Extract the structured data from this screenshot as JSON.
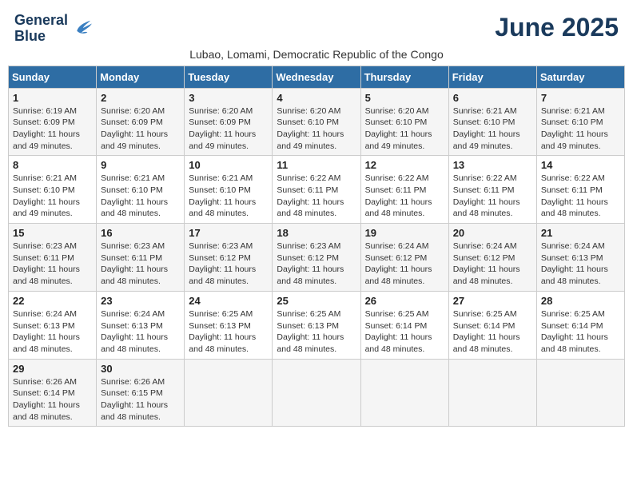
{
  "header": {
    "logo_line1": "General",
    "logo_line2": "Blue",
    "month_title": "June 2025",
    "location": "Lubao, Lomami, Democratic Republic of the Congo"
  },
  "days_of_week": [
    "Sunday",
    "Monday",
    "Tuesday",
    "Wednesday",
    "Thursday",
    "Friday",
    "Saturday"
  ],
  "weeks": [
    [
      {
        "day": "1",
        "sunrise": "6:19 AM",
        "sunset": "6:09 PM",
        "daylight": "11 hours and 49 minutes."
      },
      {
        "day": "2",
        "sunrise": "6:20 AM",
        "sunset": "6:09 PM",
        "daylight": "11 hours and 49 minutes."
      },
      {
        "day": "3",
        "sunrise": "6:20 AM",
        "sunset": "6:09 PM",
        "daylight": "11 hours and 49 minutes."
      },
      {
        "day": "4",
        "sunrise": "6:20 AM",
        "sunset": "6:10 PM",
        "daylight": "11 hours and 49 minutes."
      },
      {
        "day": "5",
        "sunrise": "6:20 AM",
        "sunset": "6:10 PM",
        "daylight": "11 hours and 49 minutes."
      },
      {
        "day": "6",
        "sunrise": "6:21 AM",
        "sunset": "6:10 PM",
        "daylight": "11 hours and 49 minutes."
      },
      {
        "day": "7",
        "sunrise": "6:21 AM",
        "sunset": "6:10 PM",
        "daylight": "11 hours and 49 minutes."
      }
    ],
    [
      {
        "day": "8",
        "sunrise": "6:21 AM",
        "sunset": "6:10 PM",
        "daylight": "11 hours and 49 minutes."
      },
      {
        "day": "9",
        "sunrise": "6:21 AM",
        "sunset": "6:10 PM",
        "daylight": "11 hours and 48 minutes."
      },
      {
        "day": "10",
        "sunrise": "6:21 AM",
        "sunset": "6:10 PM",
        "daylight": "11 hours and 48 minutes."
      },
      {
        "day": "11",
        "sunrise": "6:22 AM",
        "sunset": "6:11 PM",
        "daylight": "11 hours and 48 minutes."
      },
      {
        "day": "12",
        "sunrise": "6:22 AM",
        "sunset": "6:11 PM",
        "daylight": "11 hours and 48 minutes."
      },
      {
        "day": "13",
        "sunrise": "6:22 AM",
        "sunset": "6:11 PM",
        "daylight": "11 hours and 48 minutes."
      },
      {
        "day": "14",
        "sunrise": "6:22 AM",
        "sunset": "6:11 PM",
        "daylight": "11 hours and 48 minutes."
      }
    ],
    [
      {
        "day": "15",
        "sunrise": "6:23 AM",
        "sunset": "6:11 PM",
        "daylight": "11 hours and 48 minutes."
      },
      {
        "day": "16",
        "sunrise": "6:23 AM",
        "sunset": "6:11 PM",
        "daylight": "11 hours and 48 minutes."
      },
      {
        "day": "17",
        "sunrise": "6:23 AM",
        "sunset": "6:12 PM",
        "daylight": "11 hours and 48 minutes."
      },
      {
        "day": "18",
        "sunrise": "6:23 AM",
        "sunset": "6:12 PM",
        "daylight": "11 hours and 48 minutes."
      },
      {
        "day": "19",
        "sunrise": "6:24 AM",
        "sunset": "6:12 PM",
        "daylight": "11 hours and 48 minutes."
      },
      {
        "day": "20",
        "sunrise": "6:24 AM",
        "sunset": "6:12 PM",
        "daylight": "11 hours and 48 minutes."
      },
      {
        "day": "21",
        "sunrise": "6:24 AM",
        "sunset": "6:13 PM",
        "daylight": "11 hours and 48 minutes."
      }
    ],
    [
      {
        "day": "22",
        "sunrise": "6:24 AM",
        "sunset": "6:13 PM",
        "daylight": "11 hours and 48 minutes."
      },
      {
        "day": "23",
        "sunrise": "6:24 AM",
        "sunset": "6:13 PM",
        "daylight": "11 hours and 48 minutes."
      },
      {
        "day": "24",
        "sunrise": "6:25 AM",
        "sunset": "6:13 PM",
        "daylight": "11 hours and 48 minutes."
      },
      {
        "day": "25",
        "sunrise": "6:25 AM",
        "sunset": "6:13 PM",
        "daylight": "11 hours and 48 minutes."
      },
      {
        "day": "26",
        "sunrise": "6:25 AM",
        "sunset": "6:14 PM",
        "daylight": "11 hours and 48 minutes."
      },
      {
        "day": "27",
        "sunrise": "6:25 AM",
        "sunset": "6:14 PM",
        "daylight": "11 hours and 48 minutes."
      },
      {
        "day": "28",
        "sunrise": "6:25 AM",
        "sunset": "6:14 PM",
        "daylight": "11 hours and 48 minutes."
      }
    ],
    [
      {
        "day": "29",
        "sunrise": "6:26 AM",
        "sunset": "6:14 PM",
        "daylight": "11 hours and 48 minutes."
      },
      {
        "day": "30",
        "sunrise": "6:26 AM",
        "sunset": "6:15 PM",
        "daylight": "11 hours and 48 minutes."
      },
      null,
      null,
      null,
      null,
      null
    ]
  ]
}
